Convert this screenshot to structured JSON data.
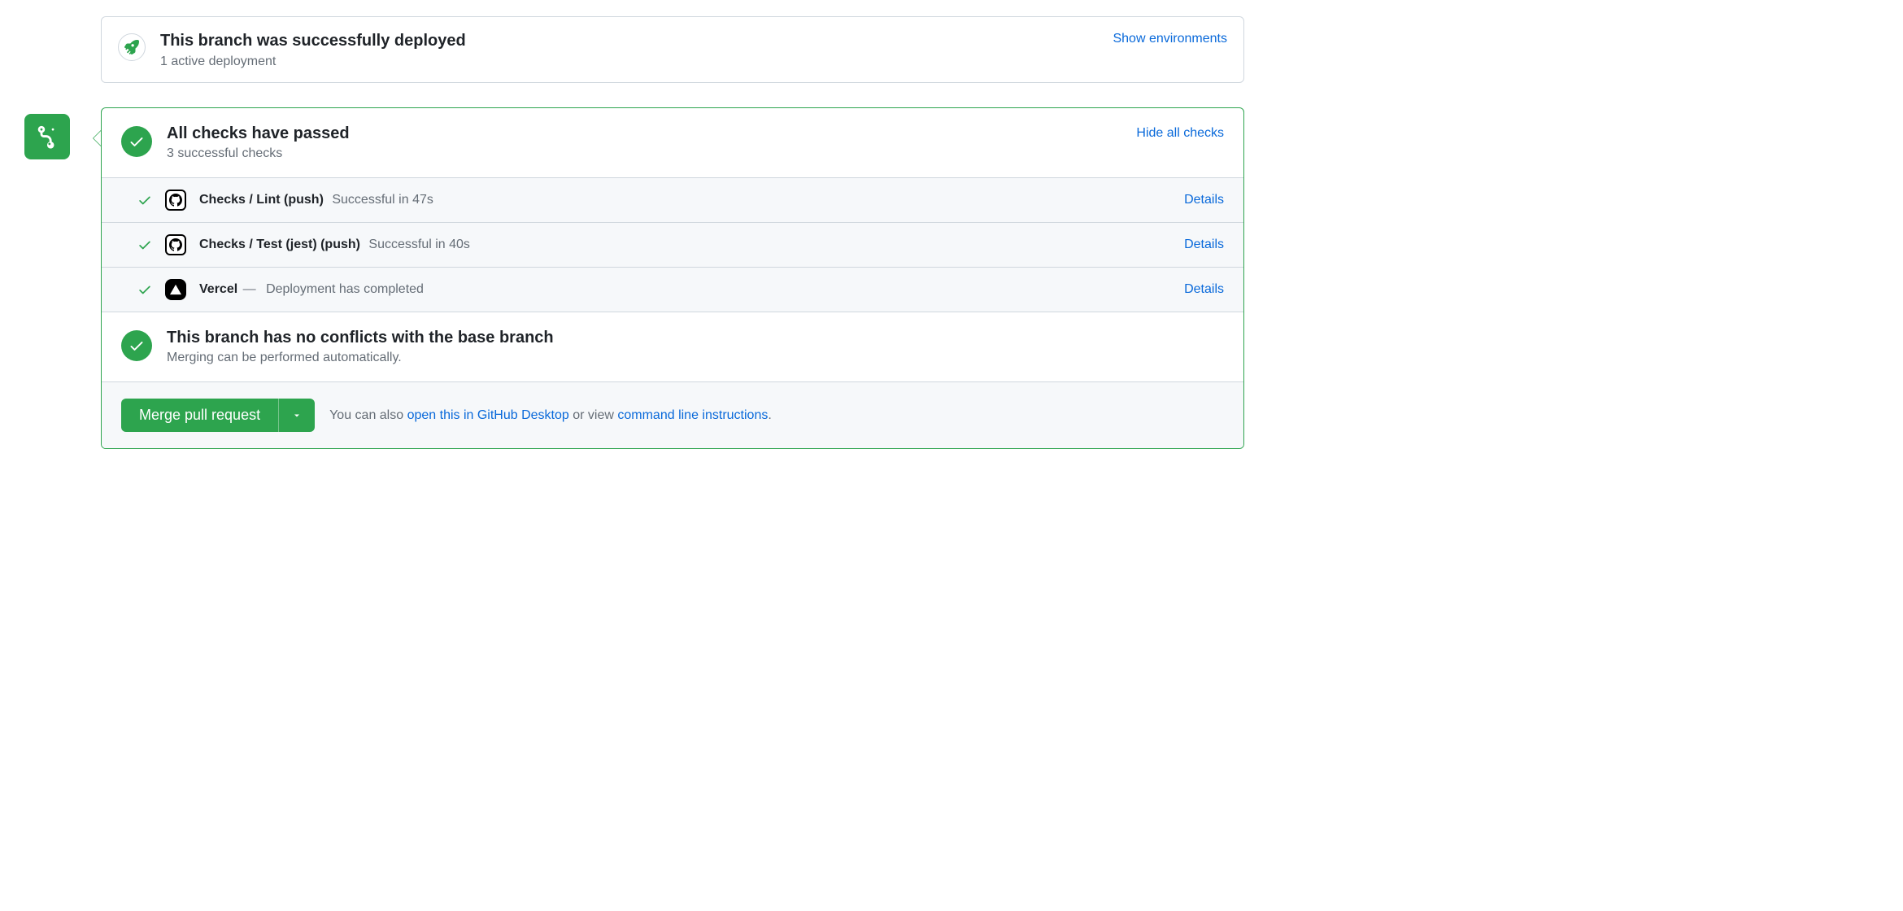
{
  "deploy": {
    "title": "This branch was successfully deployed",
    "subtitle": "1 active deployment",
    "show_env": "Show environments"
  },
  "checks_summary": {
    "title": "All checks have passed",
    "subtitle": "3 successful checks",
    "toggle": "Hide all checks"
  },
  "checks": [
    {
      "avatar": "github",
      "name": "Checks / Lint (push)",
      "sep": "",
      "status": "Successful in 47s",
      "details": "Details"
    },
    {
      "avatar": "github",
      "name": "Checks / Test (jest) (push)",
      "sep": "",
      "status": "Successful in 40s",
      "details": "Details"
    },
    {
      "avatar": "vercel",
      "name": "Vercel",
      "sep": "—",
      "status": "Deployment has completed",
      "details": "Details"
    }
  ],
  "conflicts": {
    "title": "This branch has no conflicts with the base branch",
    "subtitle": "Merging can be performed automatically."
  },
  "footer": {
    "merge_label": "Merge pull request",
    "pre": "You can also ",
    "link1": "open this in GitHub Desktop",
    "mid": " or view ",
    "link2": "command line instructions",
    "post": "."
  },
  "colors": {
    "success": "#2da44e",
    "link": "#0969da",
    "muted": "#656d76",
    "border": "#d0d7de"
  }
}
